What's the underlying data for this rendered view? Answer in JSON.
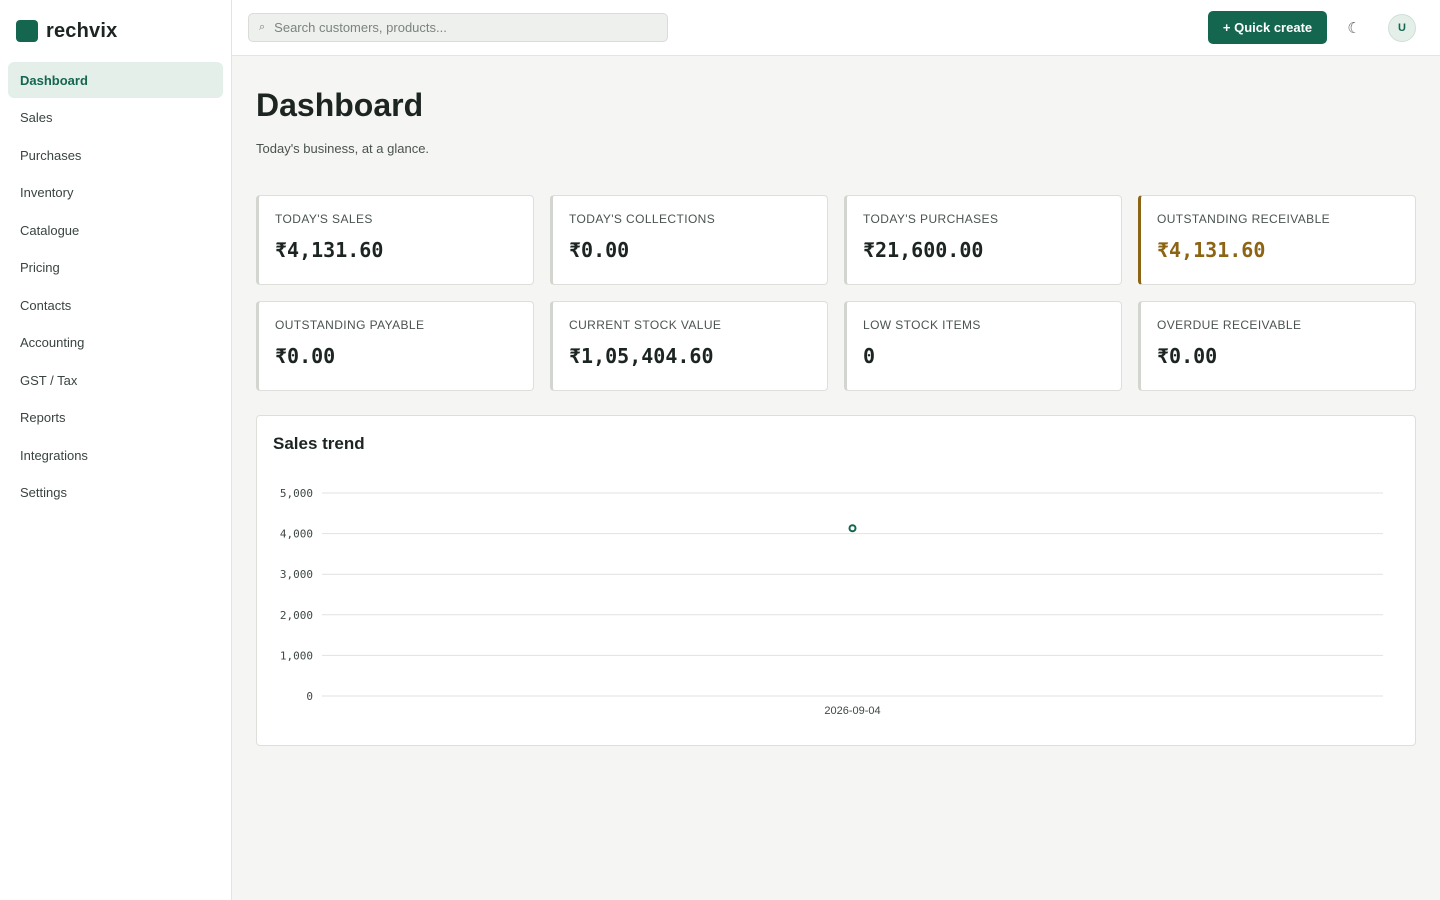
{
  "app": {
    "name": "rechvix"
  },
  "sidebar": {
    "items": [
      {
        "label": "Dashboard",
        "active": true
      },
      {
        "label": "Sales"
      },
      {
        "label": "Purchases"
      },
      {
        "label": "Inventory"
      },
      {
        "label": "Catalogue"
      },
      {
        "label": "Pricing"
      },
      {
        "label": "Contacts"
      },
      {
        "label": "Accounting"
      },
      {
        "label": "GST / Tax"
      },
      {
        "label": "Reports"
      },
      {
        "label": "Integrations"
      },
      {
        "label": "Settings"
      }
    ]
  },
  "topbar": {
    "search_placeholder": "Search customers, products...",
    "search_icon": "search-icon",
    "quick_create_label": "+ Quick create",
    "theme_icon": "moon-icon",
    "theme_glyph": "☾",
    "avatar_initial": "U"
  },
  "page": {
    "title": "Dashboard",
    "subtitle": "Today's business, at a glance."
  },
  "kpis": [
    {
      "label": "TODAY'S SALES",
      "value": "₹4,131.60"
    },
    {
      "label": "TODAY'S COLLECTIONS",
      "value": "₹0.00"
    },
    {
      "label": "TODAY'S PURCHASES",
      "value": "₹21,600.00"
    },
    {
      "label": "OUTSTANDING RECEIVABLE",
      "value": "₹4,131.60",
      "accent": "#8b6414"
    },
    {
      "label": "OUTSTANDING PAYABLE",
      "value": "₹0.00"
    },
    {
      "label": "CURRENT STOCK VALUE",
      "value": "₹1,05,404.60"
    },
    {
      "label": "LOW STOCK ITEMS",
      "value": "0"
    },
    {
      "label": "OVERDUE RECEIVABLE",
      "value": "₹0.00"
    }
  ],
  "colors": {
    "brand": "#14664f",
    "warning": "#8b6414",
    "background": "#f5f5f3",
    "surface": "#ffffff"
  },
  "chart_card": {
    "title": "Sales trend"
  },
  "chart_data": {
    "type": "line",
    "title": "Sales trend",
    "x": [
      "2026-09-04"
    ],
    "series": [
      {
        "values": [
          4131.6
        ]
      }
    ],
    "ylim": [
      0,
      5000
    ],
    "yticks": [
      0,
      1000,
      2000,
      3000,
      4000,
      5000
    ],
    "ytick_labels": [
      "0",
      "1,000",
      "2,000",
      "3,000",
      "4,000",
      "5,000"
    ],
    "grid": true,
    "legend": "none",
    "color": "#14664f"
  }
}
